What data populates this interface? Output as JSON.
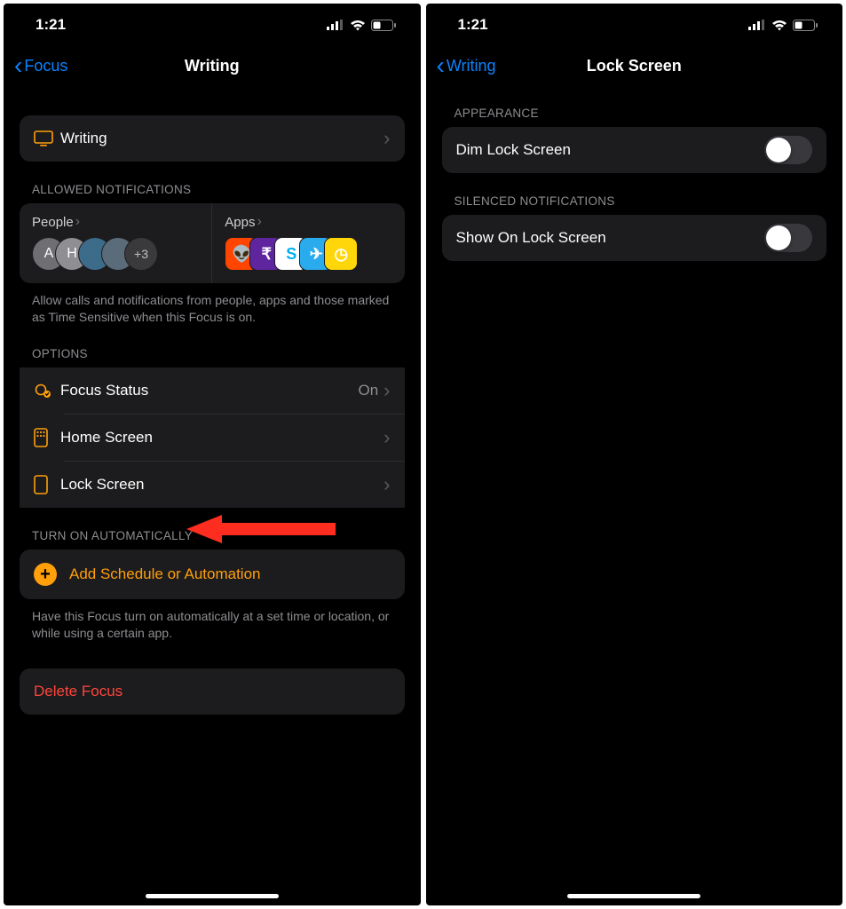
{
  "status": {
    "time": "1:21"
  },
  "left": {
    "back": "Focus",
    "title": "Writing",
    "hero": {
      "label": "Writing"
    },
    "allowed": {
      "header": "ALLOWED NOTIFICATIONS",
      "people_label": "People",
      "apps_label": "Apps",
      "people": [
        {
          "text": "A",
          "bg": "#6e6e73"
        },
        {
          "text": "H",
          "bg": "#8e8e93"
        },
        {
          "text": "",
          "bg": "#3d6b8a"
        },
        {
          "text": "",
          "bg": "#5a6b7a"
        },
        {
          "text": "+3",
          "more": true
        }
      ],
      "apps": [
        {
          "bg": "#ff4500",
          "glyph": "👽"
        },
        {
          "bg": "#5f259f",
          "glyph": "₹"
        },
        {
          "bg": "#ffffff",
          "glyph": "S",
          "fg": "#00aff0"
        },
        {
          "bg": "#2aabee",
          "glyph": "✈"
        },
        {
          "bg": "#ffd60a",
          "glyph": "◷",
          "fg": "#fff"
        }
      ],
      "footer": "Allow calls and notifications from people, apps and those marked as Time Sensitive when this Focus is on."
    },
    "options": {
      "header": "OPTIONS",
      "items": [
        {
          "icon": "focus-status",
          "label": "Focus Status",
          "detail": "On"
        },
        {
          "icon": "home-screen",
          "label": "Home Screen"
        },
        {
          "icon": "lock-screen",
          "label": "Lock Screen"
        }
      ]
    },
    "auto": {
      "header": "TURN ON AUTOMATICALLY",
      "add_label": "Add Schedule or Automation",
      "footer": "Have this Focus turn on automatically at a set time or location, or while using a certain app."
    },
    "delete_label": "Delete Focus"
  },
  "right": {
    "back": "Writing",
    "title": "Lock Screen",
    "appearance": {
      "header": "APPEARANCE",
      "dim_label": "Dim Lock Screen",
      "dim_on": false
    },
    "silenced": {
      "header": "SILENCED NOTIFICATIONS",
      "show_label": "Show On Lock Screen",
      "show_on": false
    }
  }
}
